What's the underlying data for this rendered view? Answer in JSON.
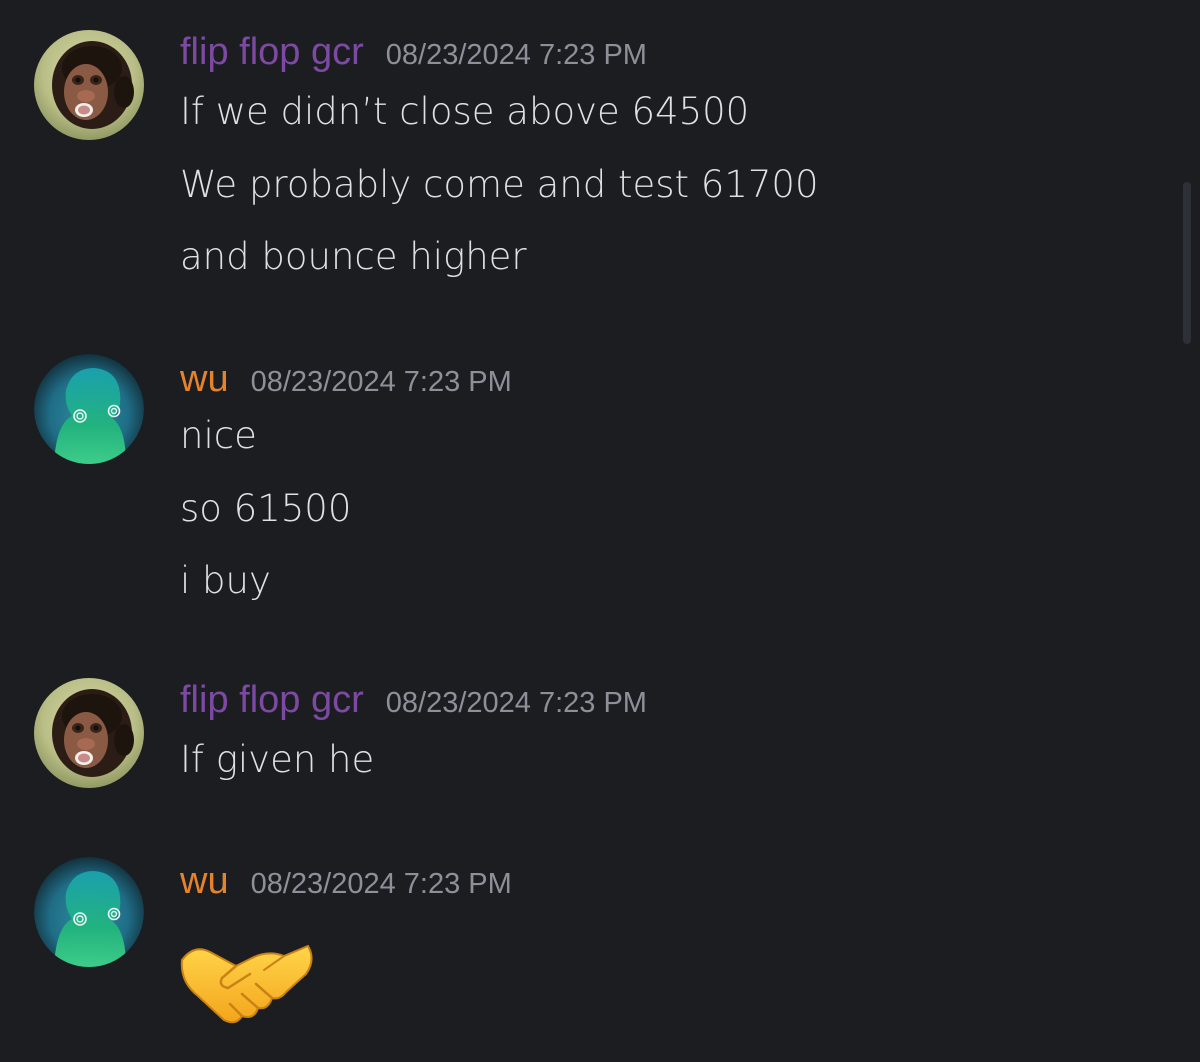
{
  "messages": [
    {
      "username": "flip flop gcr",
      "username_color": "#7d4aa3",
      "timestamp": "08/23/2024 7:23 PM",
      "avatar_icon": "monkey-avatar-icon",
      "lines": [
        "If we didn’t close above 64500",
        "We probably come and test 61700",
        "and bounce higher"
      ]
    },
    {
      "username": "wu",
      "username_color": "#e5832c",
      "timestamp": "08/23/2024 7:23 PM",
      "avatar_icon": "alien-avatar-icon",
      "lines": [
        "nice",
        "so 61500",
        "i buy"
      ]
    },
    {
      "username": "flip flop gcr",
      "username_color": "#7d4aa3",
      "timestamp": "08/23/2024 7:23 PM",
      "avatar_icon": "monkey-avatar-icon",
      "lines": [
        "If given he"
      ]
    },
    {
      "username": "wu",
      "username_color": "#e5832c",
      "timestamp": "08/23/2024 7:23 PM",
      "avatar_icon": "alien-avatar-icon",
      "lines": [],
      "emoji": "handshake-emoji-icon"
    }
  ],
  "colors": {
    "background": "#1c1d21",
    "message_text": "#dfe0e4",
    "timestamp_text": "#8e9099",
    "scrollbar": "#2e3037"
  }
}
